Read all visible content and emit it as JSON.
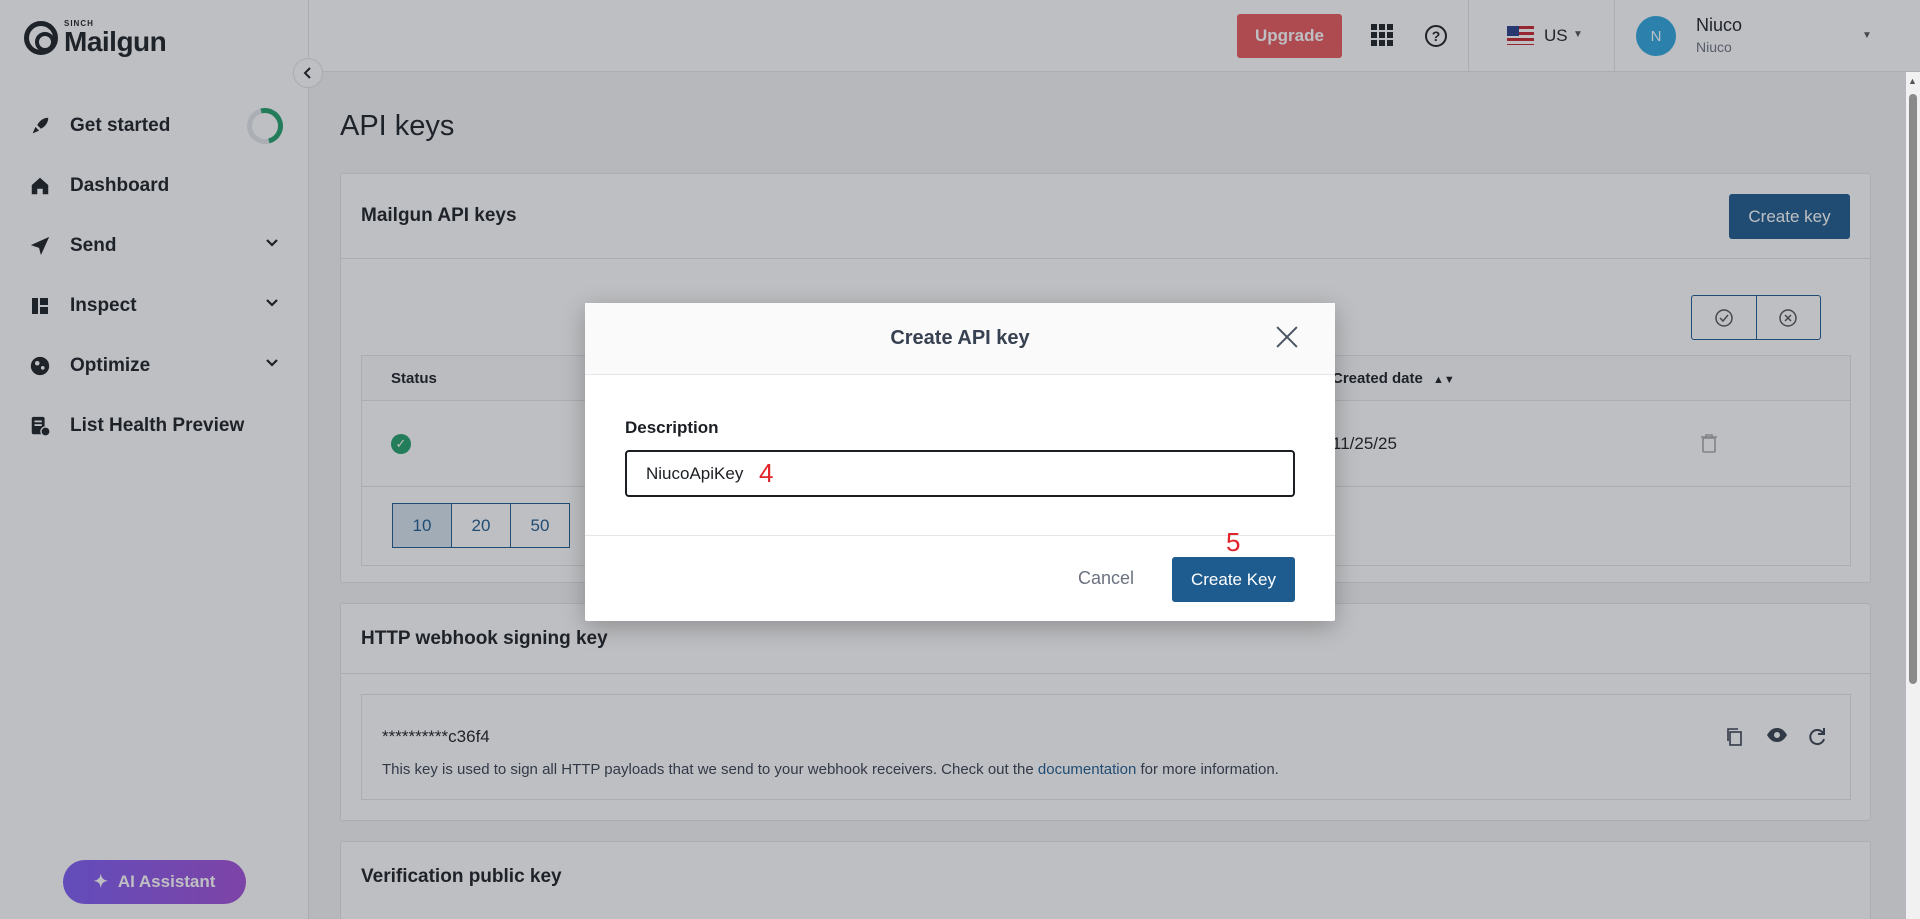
{
  "brand": {
    "small": "SINCH",
    "name": "Mailgun"
  },
  "sidebar": {
    "items": [
      {
        "label": "Get started",
        "icon": "rocket-icon"
      },
      {
        "label": "Dashboard",
        "icon": "home-icon"
      },
      {
        "label": "Send",
        "icon": "send-icon"
      },
      {
        "label": "Inspect",
        "icon": "inspect-icon"
      },
      {
        "label": "Optimize",
        "icon": "optimize-icon"
      },
      {
        "label": "List Health Preview",
        "icon": "list-health-icon"
      }
    ],
    "ai_assistant": "AI Assistant"
  },
  "topbar": {
    "upgrade": "Upgrade",
    "region": "US",
    "user": {
      "initial": "N",
      "name": "Niuco",
      "sub": "Niuco"
    }
  },
  "page": {
    "title": "API keys",
    "api_keys_card": {
      "title": "Mailgun API keys",
      "create_key": "Create key",
      "columns": {
        "status": "Status",
        "created": "Created date"
      },
      "rows": [
        {
          "created": "11/25/25"
        }
      ],
      "page_sizes": [
        "10",
        "20",
        "50"
      ]
    },
    "webhook_card": {
      "title": "HTTP webhook signing key",
      "key": "**********c36f4",
      "desc_before": "This key is used to sign all HTTP payloads that we send to your webhook receivers. Check out the ",
      "desc_link": "documentation",
      "desc_after": " for more information."
    },
    "verification_card": {
      "title": "Verification public key"
    }
  },
  "modal": {
    "title": "Create API key",
    "field_label": "Description",
    "field_value": "NiucoApiKey",
    "cancel": "Cancel",
    "submit": "Create Key"
  },
  "annotations": {
    "step4": "4",
    "step5": "5"
  },
  "colors": {
    "primary": "#1e5b8f",
    "upgrade": "#e8595c",
    "success": "#21a06b",
    "annotation": "#e0242a"
  }
}
